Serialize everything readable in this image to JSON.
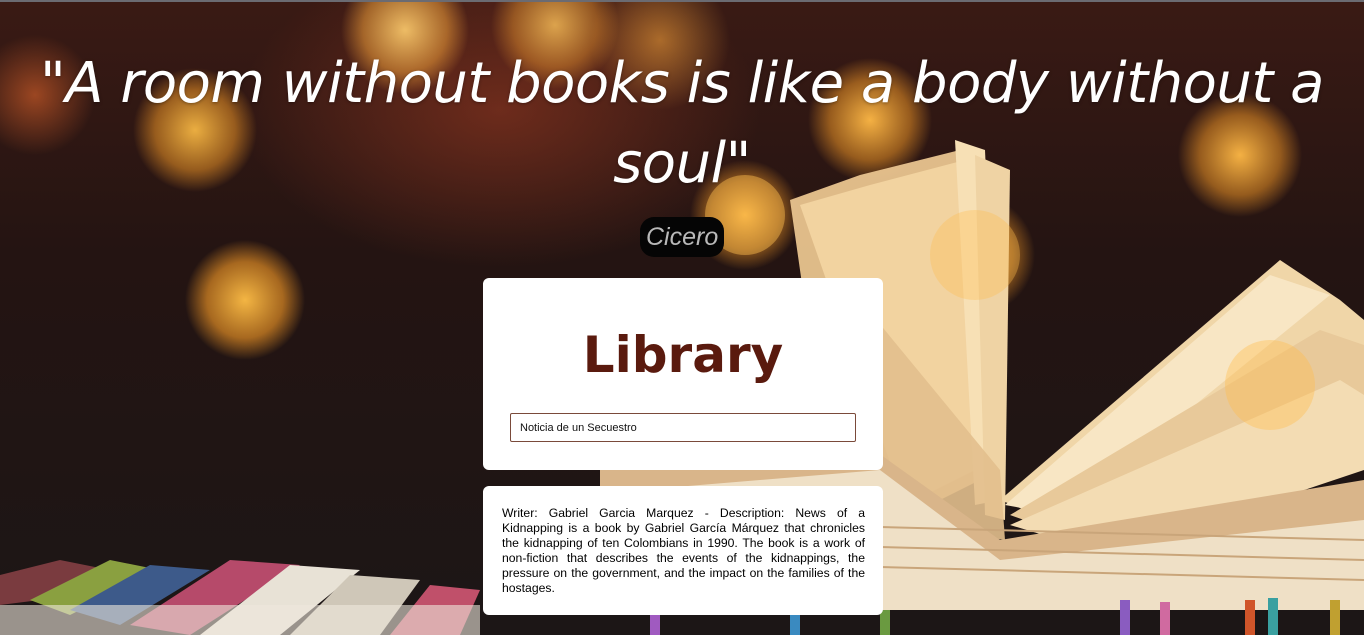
{
  "hero": {
    "quote": "\"A room without books is like a body without a soul\"",
    "author": "Cicero"
  },
  "library": {
    "title": "Library",
    "search": {
      "value": "Noticia de un Secuestro"
    }
  },
  "result": {
    "description": "Writer: Gabriel Garcia Marquez - Description: News of a Kidnapping is a book by Gabriel García Márquez that chronicles the kidnapping of ten Colombians in 1990. The book is a work of non-fiction that describes the events of the kidnappings, the pressure on the government, and the impact on the families of the hostages."
  },
  "colors": {
    "title": "#5a1a0e",
    "author_badge": "#050505",
    "card": "#ffffff"
  }
}
